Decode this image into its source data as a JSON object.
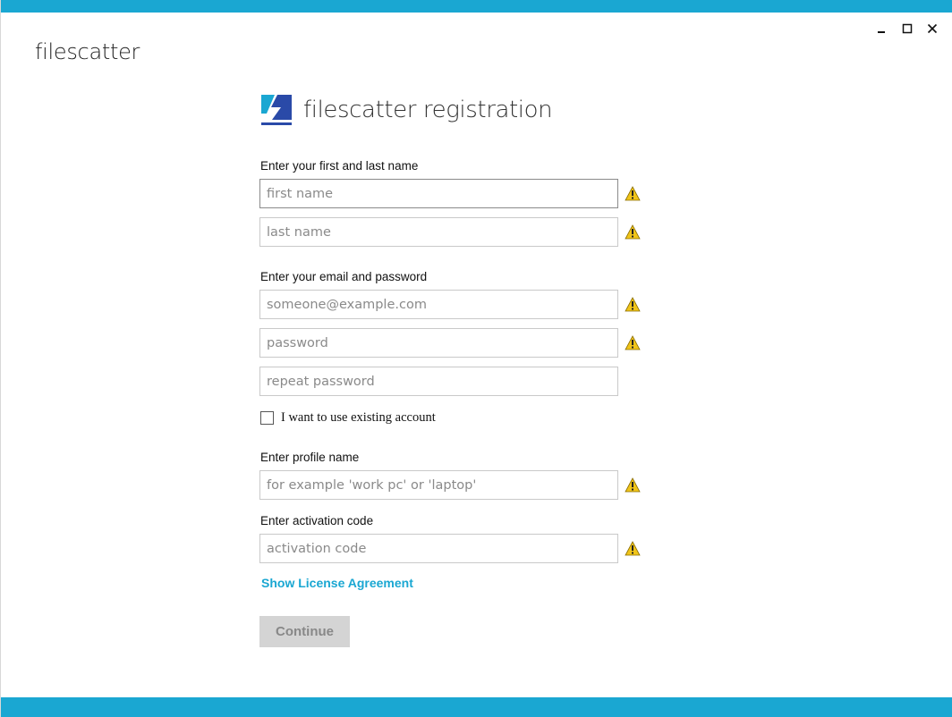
{
  "window": {
    "app_name": "filescatter",
    "controls": {
      "minimize_glyph": "_",
      "maximize_glyph": "☐",
      "close_glyph": "✕"
    }
  },
  "header": {
    "title": "filescatter registration",
    "logo_icon": "filescatter-logo-icon"
  },
  "name_section": {
    "label": "Enter your first and last name",
    "first_name": {
      "value": "",
      "placeholder": "first name"
    },
    "last_name": {
      "value": "",
      "placeholder": "last name"
    }
  },
  "account_section": {
    "label": "Enter your email and password",
    "email": {
      "value": "",
      "placeholder": "someone@example.com"
    },
    "password": {
      "value": "",
      "placeholder": "password"
    },
    "repeat_password": {
      "value": "",
      "placeholder": "repeat password"
    },
    "existing_account_label": "I want to use existing account",
    "existing_account_checked": false
  },
  "profile_section": {
    "label": "Enter profile name",
    "profile_name": {
      "value": "",
      "placeholder": "for example 'work pc' or 'laptop'"
    }
  },
  "activation_section": {
    "label": "Enter activation code",
    "activation_code": {
      "value": "",
      "placeholder": "activation code"
    }
  },
  "license_link": "Show License Agreement",
  "continue_button": "Continue",
  "icons": {
    "warning": "warning-icon"
  },
  "colors": {
    "accent": "#1aa7d2",
    "warning_fill": "#f0c419",
    "disabled_button_bg": "#d4d4d4",
    "disabled_button_text": "#888888"
  }
}
